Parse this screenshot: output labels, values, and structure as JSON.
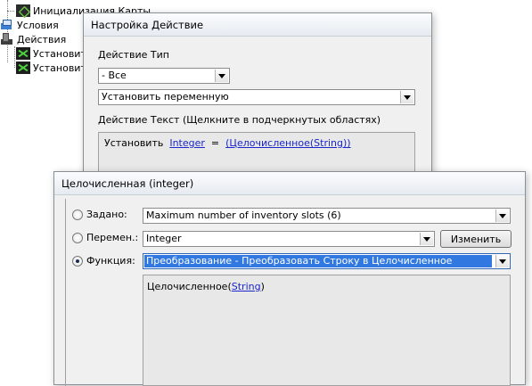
{
  "tree": {
    "map_init": "Инициализация Карты",
    "conditions": "Условия",
    "actions": "Действия",
    "set1": "Установит",
    "set2": "Установит"
  },
  "back_dialog": {
    "title": "Настройка Действие",
    "type_label": "Действие Тип",
    "type_value": "- Все",
    "action_value": "Установить переменную",
    "text_label": "Действие Текст (Щелкните в подчеркнутых областях)",
    "text_prefix": "Установить",
    "text_var": "Integer",
    "text_eq": "=",
    "text_func": "(Целочисленное(String))"
  },
  "front_dialog": {
    "title": "Целочисленная (integer)",
    "preset_label": "Задано:",
    "preset_value": "Maximum number of inventory slots (6)",
    "variable_label": "Перемен.:",
    "variable_value": "Integer",
    "edit_button": "Изменить",
    "function_label": "Функция:",
    "function_value": "Преобразование - Преобразовать Строку в Целочисленное",
    "func_text_prefix": "Целочисленное(",
    "func_text_arg": "String",
    "func_text_suffix": ")",
    "selected_radio": "function"
  },
  "colors": {
    "link": "#1a26c8",
    "selection": "#3178e0"
  }
}
